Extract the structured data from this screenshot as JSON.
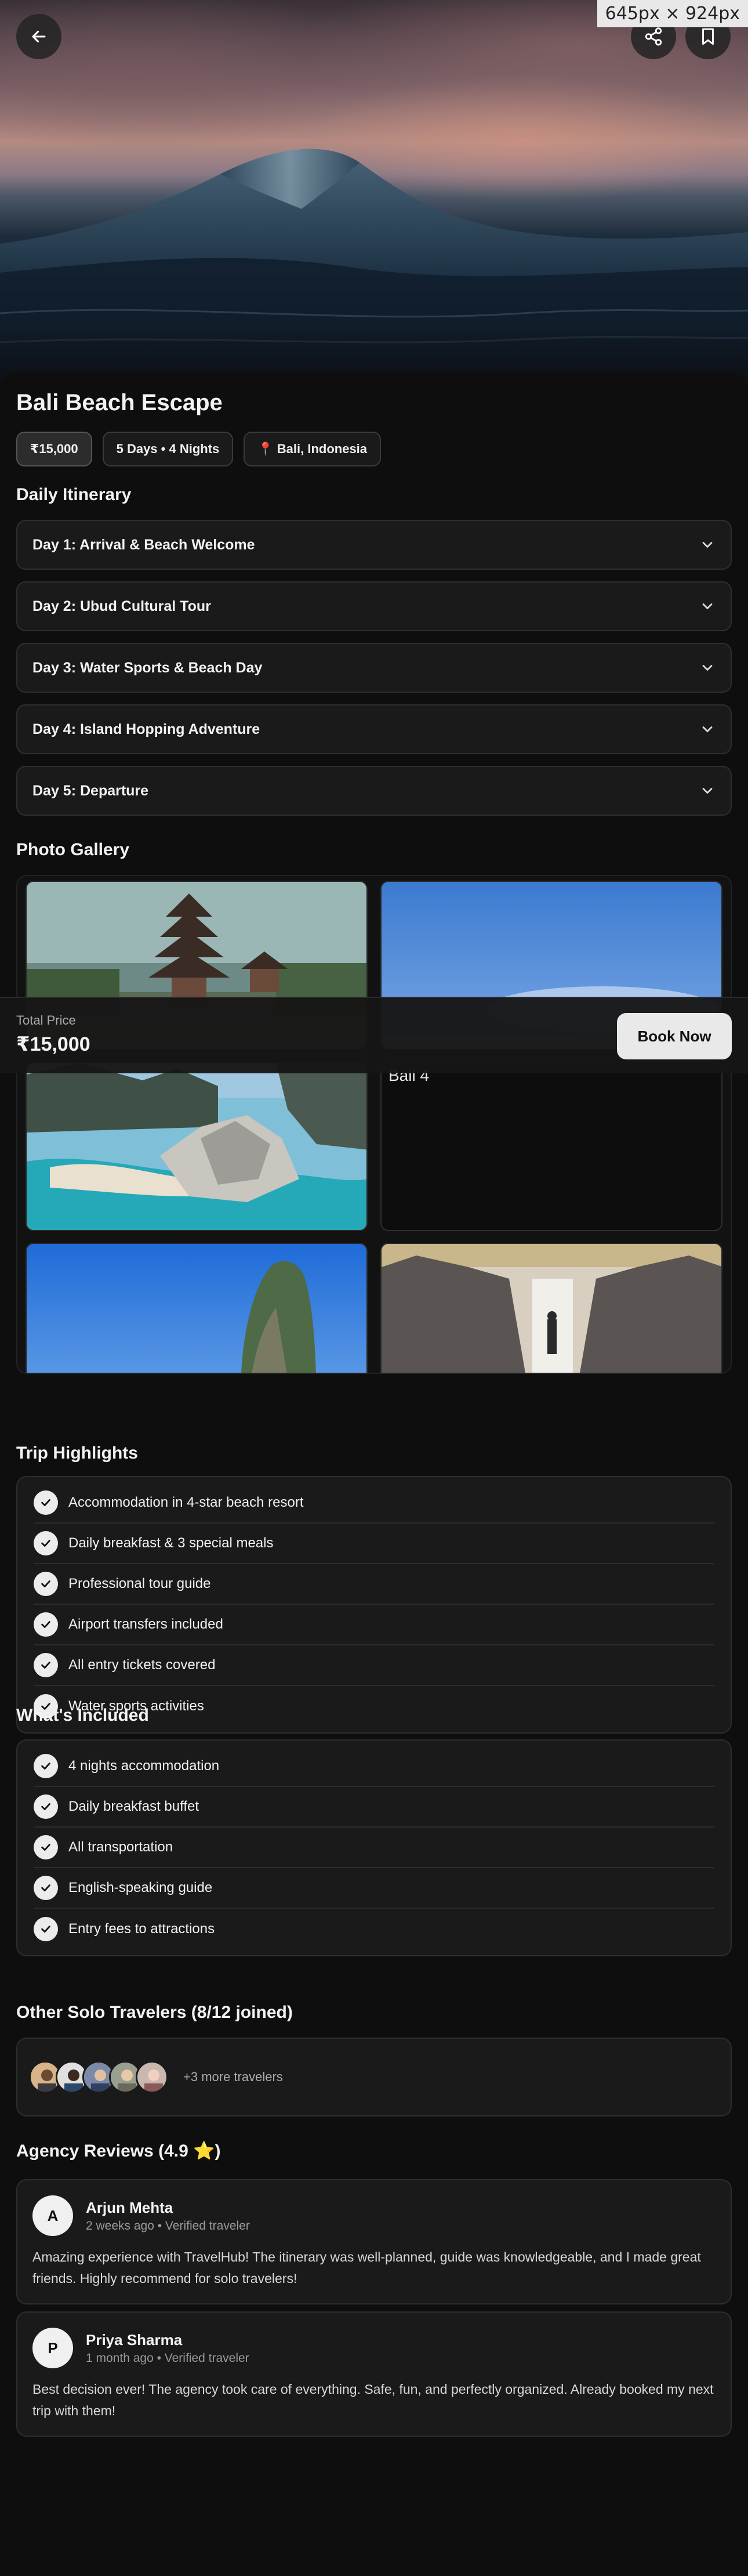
{
  "overlay": {
    "size_label": "645px × 924px"
  },
  "header": {
    "back_icon": "arrow-left-icon",
    "share_icon": "share-icon",
    "bookmark_icon": "bookmark-icon"
  },
  "trip": {
    "title": "Bali Beach Escape",
    "chips": {
      "price": "₹15,000",
      "duration": "5 Days • 4 Nights",
      "location": "📍 Bali, Indonesia"
    }
  },
  "itinerary": {
    "heading": "Daily Itinerary",
    "days": [
      "Day 1: Arrival & Beach Welcome",
      "Day 2: Ubud Cultural Tour",
      "Day 3: Water Sports & Beach Day",
      "Day 4: Island Hopping Adventure",
      "Day 5: Departure"
    ]
  },
  "gallery": {
    "heading": "Photo Gallery",
    "broken_alt": "Bali 4"
  },
  "booking": {
    "total_label": "Total Price",
    "total_value": "₹15,000",
    "book_label": "Book Now"
  },
  "highlights": {
    "heading": "Trip Highlights",
    "items": [
      "Accommodation in 4-star beach resort",
      "Daily breakfast & 3 special meals",
      "Professional tour guide",
      "Airport transfers included",
      "All entry tickets covered",
      "Water sports activities"
    ]
  },
  "included": {
    "heading": "What's Included",
    "items": [
      "4 nights accommodation",
      "Daily breakfast buffet",
      "All transportation",
      "English-speaking guide",
      "Entry fees to attractions"
    ]
  },
  "travelers": {
    "heading": "Other Solo Travelers (8/12 joined)",
    "more": "+3 more travelers"
  },
  "reviews": {
    "heading": "Agency Reviews (4.9 ⭐)",
    "items": [
      {
        "initial": "A",
        "name": "Arjun Mehta",
        "meta": "2 weeks ago • Verified traveler",
        "text": "Amazing experience with TravelHub! The itinerary was well-planned, guide was knowledgeable, and I made great friends. Highly recommend for solo travelers!"
      },
      {
        "initial": "P",
        "name": "Priya Sharma",
        "meta": "1 month ago • Verified traveler",
        "text": "Best decision ever! The agency took care of everything. Safe, fun, and perfectly organized. Already booked my next trip with them!"
      }
    ]
  }
}
